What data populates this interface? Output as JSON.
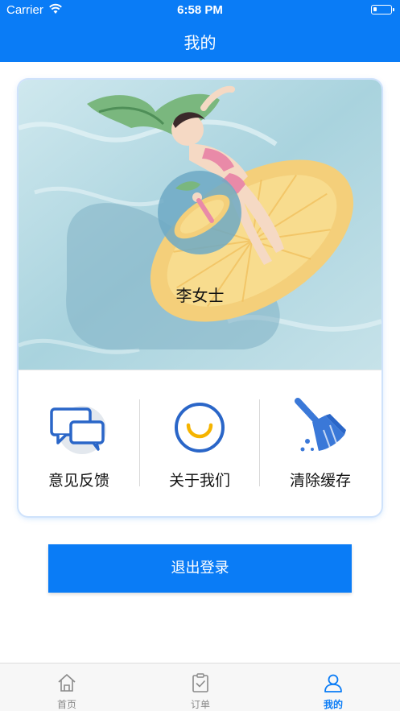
{
  "status_bar": {
    "carrier": "Carrier",
    "time": "6:58 PM"
  },
  "nav": {
    "title": "我的"
  },
  "profile": {
    "username": "李女士"
  },
  "actions": [
    {
      "label": "意见反馈",
      "icon": "feedback-chat-icon"
    },
    {
      "label": "关于我们",
      "icon": "smile-circle-icon"
    },
    {
      "label": "清除缓存",
      "icon": "broom-icon"
    }
  ],
  "logout": {
    "label": "退出登录"
  },
  "tabbar": {
    "items": [
      {
        "label": "首页",
        "icon": "home-icon",
        "active": false
      },
      {
        "label": "订单",
        "icon": "clipboard-icon",
        "active": false
      },
      {
        "label": "我的",
        "icon": "user-icon",
        "active": true
      }
    ]
  },
  "colors": {
    "primary": "#0a7cf6",
    "icon_accent": "#f5b400",
    "text": "#111111",
    "tab_inactive": "#8a8a8a"
  }
}
